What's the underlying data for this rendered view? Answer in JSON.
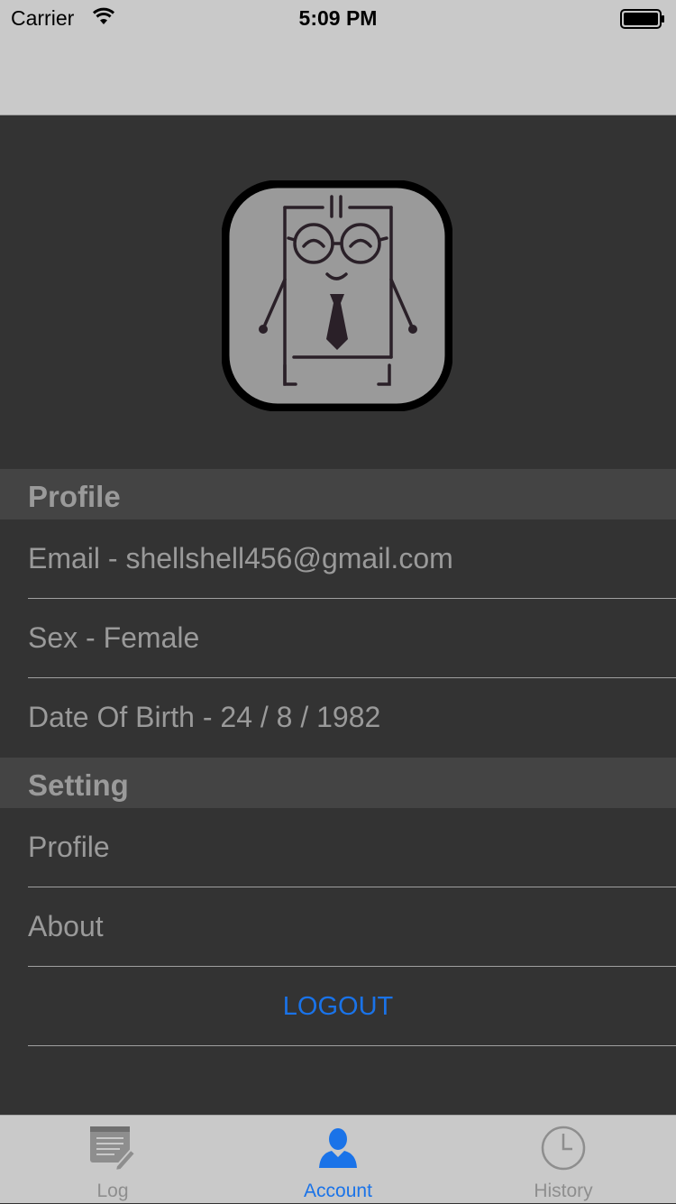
{
  "status_bar": {
    "carrier": "Carrier",
    "time": "5:09 PM"
  },
  "profile_section": {
    "title": "Profile",
    "rows": [
      {
        "label": "Email - shellshell456@gmail.com"
      },
      {
        "label": "Sex - Female"
      },
      {
        "label": "Date Of Birth - 24 / 8 / 1982"
      }
    ]
  },
  "setting_section": {
    "title": "Setting",
    "rows": [
      {
        "label": "Profile"
      },
      {
        "label": "About"
      }
    ]
  },
  "logout": {
    "label": "LOGOUT",
    "color": "#1a73e8"
  },
  "tab_bar": {
    "tabs": [
      {
        "label": "Log",
        "icon": "notepad-pencil-icon"
      },
      {
        "label": "Account",
        "icon": "person-icon",
        "active": true
      },
      {
        "label": "History",
        "icon": "clock-icon"
      }
    ]
  },
  "colors": {
    "accent": "#1a73e8",
    "background": "#333333",
    "header": "#444444",
    "bar": "#c9c9c9"
  }
}
